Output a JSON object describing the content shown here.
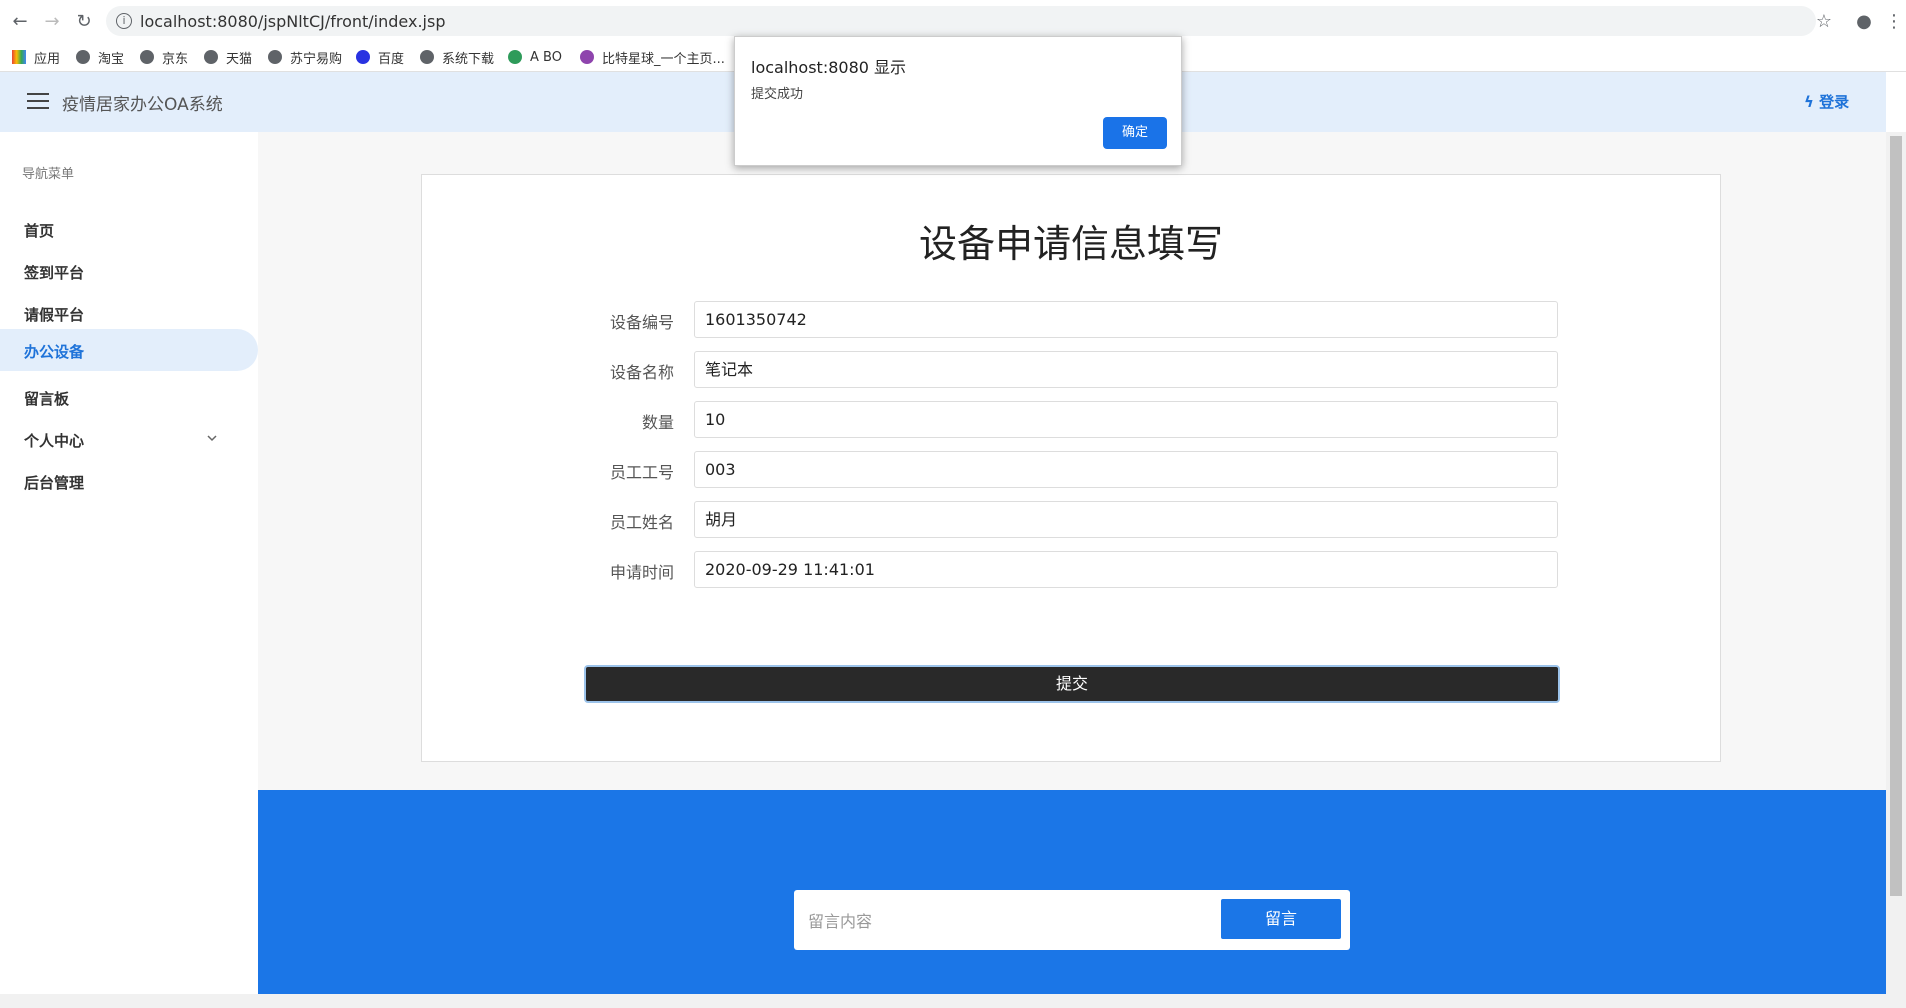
{
  "browser": {
    "url": "localhost:8080/jspNltCJ/front/index.jsp",
    "bookmarks": [
      "应用",
      "淘宝",
      "京东",
      "天猫",
      "苏宁易购",
      "百度",
      "系统下载",
      "A BO",
      "比特星球_一个主页..."
    ]
  },
  "header": {
    "title": "疫情居家办公OA系统",
    "login_label": "登录"
  },
  "sidebar": {
    "caption": "导航菜单",
    "items": [
      {
        "label": "首页"
      },
      {
        "label": "签到平台"
      },
      {
        "label": "请假平台"
      },
      {
        "label": "办公设备",
        "active": true
      },
      {
        "label": "留言板"
      },
      {
        "label": "个人中心",
        "expandable": true
      },
      {
        "label": "后台管理"
      }
    ]
  },
  "form": {
    "title": "设备申请信息填写",
    "fields": [
      {
        "label": "设备编号",
        "value": "1601350742"
      },
      {
        "label": "设备名称",
        "value": "笔记本"
      },
      {
        "label": "数量",
        "value": "10"
      },
      {
        "label": "员工工号",
        "value": "003"
      },
      {
        "label": "员工姓名",
        "value": "胡月"
      },
      {
        "label": "申请时间",
        "value": "2020-09-29 11:41:01"
      }
    ],
    "submit_label": "提交"
  },
  "footer": {
    "message_placeholder": "留言内容",
    "message_button": "留言"
  },
  "dialog": {
    "title": "localhost:8080 显示",
    "message": "提交成功",
    "ok_label": "确定"
  },
  "colors": {
    "accent": "#1b76e7",
    "header_bg": "#e3eefb",
    "submit_bg": "#292929"
  }
}
